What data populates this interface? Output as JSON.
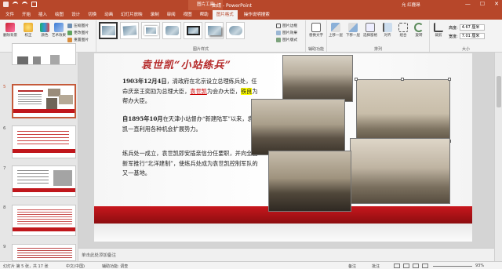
{
  "titlebar": {
    "doc_title": "曲靖 - PowerPoint",
    "context_group": "图片工具",
    "user": "允 红鹿昂",
    "min": "—",
    "max": "☐",
    "close": "✕"
  },
  "tabs": [
    "文件",
    "开始",
    "插入",
    "绘图",
    "设计",
    "切换",
    "动画",
    "幻灯片放映",
    "录制",
    "审阅",
    "视图",
    "帮助",
    "图片格式"
  ],
  "active_tab": "图片格式",
  "tell_me": "操作说明搜索",
  "ribbon": {
    "adjust": {
      "label": "调整",
      "remove_bg": "删除背景",
      "corrections": "校正",
      "color": "颜色",
      "artistic": "艺术效果",
      "compress": "压缩图片",
      "change": "更改图片",
      "reset": "重置图片"
    },
    "styles_label": "图片样式",
    "border": "图片边框",
    "effects": "图片效果",
    "layout": "图片版式",
    "access_label": "辅助功能",
    "alt_text": "替换文字",
    "arrange": {
      "label": "排列",
      "forward": "上移一层",
      "backward": "下移一层",
      "pane": "选择窗格",
      "align": "对齐",
      "group": "组合",
      "rotate": "旋转"
    },
    "size": {
      "label": "大小",
      "crop": "裁剪",
      "height_label": "高度:",
      "height": "4.67 厘米",
      "width_label": "宽度:",
      "width": "7.01 厘米"
    }
  },
  "slides_panel": [
    {
      "num": "5"
    },
    {
      "num": "6"
    },
    {
      "num": "7"
    },
    {
      "num": "8"
    },
    {
      "num": "9"
    }
  ],
  "slide": {
    "title": "袁世凯“小站练兵”",
    "p1_date": "1903年12月4日",
    "p1_a": "，清政府在北京设立总理练兵处，任命庆亲王奕劻为总理大臣，",
    "p1_name1": "袁世凯",
    "p1_b": "为会办大臣，",
    "p1_name2": "铁良",
    "p1_c": "为帮办大臣。",
    "p2_date": "自1895年10月",
    "p2_rest": "在天津小站督办“新建陆军”以来，袁世凯一直利用各种机会扩展势力。",
    "p3": "练兵处一成立，袁世凯即安插亲信分任要职，并向全国新军推行“北洋建制”，使练兵处成为袁世凯控制军队的又一基地。"
  },
  "notes_placeholder": "单击此处添加备注",
  "status": {
    "slide_info": "幻灯片 第 5 张，共 17 张",
    "language": "中文(中国)",
    "accessibility": "辅助功能: 调查",
    "notes": "备注",
    "comments": "批注",
    "zoom": "93%"
  },
  "colors": {
    "accent": "#b7472a",
    "title_red": "#b52a2a",
    "band_red": "#c8171d",
    "highlight": "#ffff00"
  }
}
